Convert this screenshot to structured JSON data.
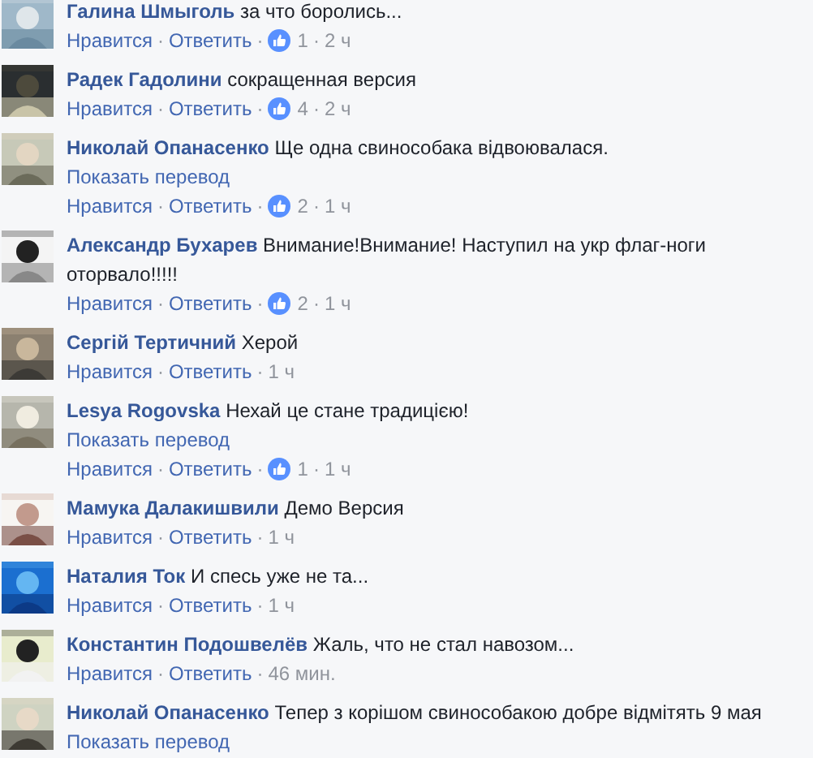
{
  "comments": [
    {
      "author": "Галина Шмыголь",
      "text": "за что боролись...",
      "meta": [
        {
          "kind": "link",
          "text": "Нравится"
        },
        {
          "kind": "dot",
          "text": "·"
        },
        {
          "kind": "link",
          "text": "Ответить"
        },
        {
          "kind": "dot",
          "text": "·"
        },
        {
          "kind": "likes",
          "text": "1"
        },
        {
          "kind": "dot",
          "text": "·"
        },
        {
          "kind": "time",
          "text": "2 ч"
        }
      ]
    },
    {
      "author": "Радек Гадолини",
      "text": "сокращенная версия",
      "meta": [
        {
          "kind": "link",
          "text": "Нравится"
        },
        {
          "kind": "dot",
          "text": "·"
        },
        {
          "kind": "link",
          "text": "Ответить"
        },
        {
          "kind": "dot",
          "text": "·"
        },
        {
          "kind": "likes",
          "text": "4"
        },
        {
          "kind": "dot",
          "text": "·"
        },
        {
          "kind": "time",
          "text": "2 ч"
        }
      ]
    },
    {
      "author": "Николай Опанасенко",
      "text": "Ще одна свинособака відвоювалася.",
      "translate": "Показать перевод",
      "meta": [
        {
          "kind": "link",
          "text": "Нравится"
        },
        {
          "kind": "dot",
          "text": "·"
        },
        {
          "kind": "link",
          "text": "Ответить"
        },
        {
          "kind": "dot",
          "text": "·"
        },
        {
          "kind": "likes",
          "text": "2"
        },
        {
          "kind": "dot",
          "text": "·"
        },
        {
          "kind": "time",
          "text": "1 ч"
        }
      ]
    },
    {
      "author": "Александр Бухарев",
      "text": "Внимание!Внимание! Наступил на укр флаг-ноги оторвало!!!!!",
      "meta": [
        {
          "kind": "link",
          "text": "Нравится"
        },
        {
          "kind": "dot",
          "text": "·"
        },
        {
          "kind": "link",
          "text": "Ответить"
        },
        {
          "kind": "dot",
          "text": "·"
        },
        {
          "kind": "likes",
          "text": "2"
        },
        {
          "kind": "dot",
          "text": "·"
        },
        {
          "kind": "time",
          "text": "1 ч"
        }
      ]
    },
    {
      "author": "Сергій Тертичний",
      "text": "Херой",
      "meta": [
        {
          "kind": "link",
          "text": "Нравится"
        },
        {
          "kind": "dot",
          "text": "·"
        },
        {
          "kind": "link",
          "text": "Ответить"
        },
        {
          "kind": "dot",
          "text": "·"
        },
        {
          "kind": "time",
          "text": "1 ч"
        }
      ]
    },
    {
      "author": "Lesya Rogovska",
      "text": "Нехай це стане традицією!",
      "translate": "Показать перевод",
      "meta": [
        {
          "kind": "link",
          "text": "Нравится"
        },
        {
          "kind": "dot",
          "text": "·"
        },
        {
          "kind": "link",
          "text": "Ответить"
        },
        {
          "kind": "dot",
          "text": "·"
        },
        {
          "kind": "likes",
          "text": "1"
        },
        {
          "kind": "dot",
          "text": "·"
        },
        {
          "kind": "time",
          "text": "1 ч"
        }
      ]
    },
    {
      "author": "Мамука Далакишвили",
      "text": "Демо Версия",
      "meta": [
        {
          "kind": "link",
          "text": "Нравится"
        },
        {
          "kind": "dot",
          "text": "·"
        },
        {
          "kind": "link",
          "text": "Ответить"
        },
        {
          "kind": "dot",
          "text": "·"
        },
        {
          "kind": "time",
          "text": "1 ч"
        }
      ]
    },
    {
      "author": "Наталия Ток",
      "text": "И спесь уже не та...",
      "meta": [
        {
          "kind": "link",
          "text": "Нравится"
        },
        {
          "kind": "dot",
          "text": "·"
        },
        {
          "kind": "link",
          "text": "Ответить"
        },
        {
          "kind": "dot",
          "text": "·"
        },
        {
          "kind": "time",
          "text": "1 ч"
        }
      ]
    },
    {
      "author": "Константин Подошвелёв",
      "text": "Жаль, что не стал навозом...",
      "meta": [
        {
          "kind": "link",
          "text": "Нравится"
        },
        {
          "kind": "dot",
          "text": "·"
        },
        {
          "kind": "link",
          "text": "Ответить"
        },
        {
          "kind": "dot",
          "text": "·"
        },
        {
          "kind": "time",
          "text": "46 мин."
        }
      ]
    },
    {
      "author": "Николай Опанасенко",
      "text": "Тепер з корішом свинособакою добре відмітять 9 мая",
      "translate": "Показать перевод"
    }
  ]
}
